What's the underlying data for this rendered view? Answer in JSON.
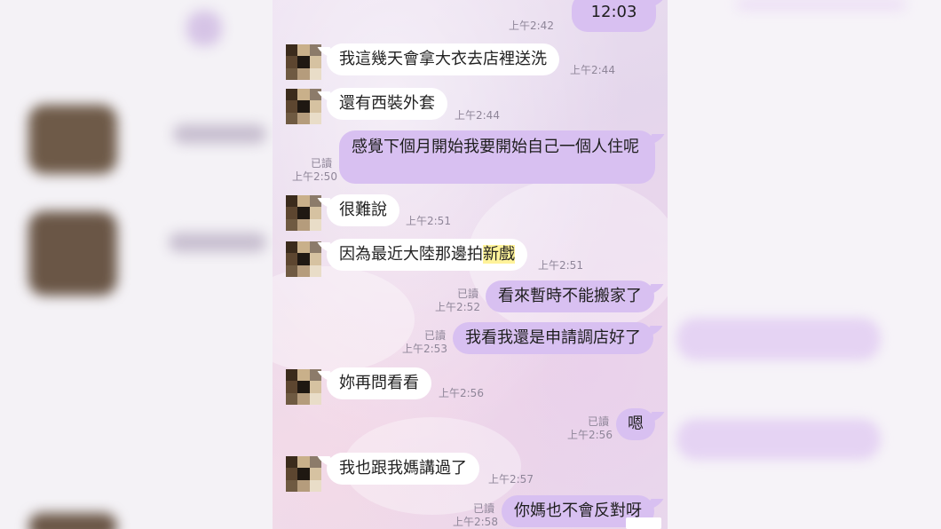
{
  "chat": {
    "messages": [
      {
        "side": "out",
        "text": "12:03",
        "time": "上午2:42",
        "read": ""
      },
      {
        "side": "in",
        "text": "我這幾天會拿大衣去店裡送洗",
        "time": "上午2:44"
      },
      {
        "side": "in",
        "text": "還有西裝外套",
        "time": "上午2:44"
      },
      {
        "side": "out",
        "text": "感覺下個月開始我要開始自己一個人住呢",
        "time": "上午2:50",
        "read": "已讀"
      },
      {
        "side": "in",
        "text": "很難說",
        "time": "上午2:51"
      },
      {
        "side": "in",
        "text_plain": "因為最近大陸那邊拍",
        "text_highlight": "新戲",
        "time": "上午2:51"
      },
      {
        "side": "out",
        "text": "看來暫時不能搬家了",
        "time": "上午2:52",
        "read": "已讀"
      },
      {
        "side": "out",
        "text": "我看我還是申請調店好了",
        "time": "上午2:53",
        "read": "已讀"
      },
      {
        "side": "in",
        "text": "妳再問看看",
        "time": "上午2:56"
      },
      {
        "side": "out",
        "text": "嗯",
        "time": "上午2:56",
        "read": "已讀"
      },
      {
        "side": "in",
        "text": "我也跟我媽講過了",
        "time": "上午2:57"
      },
      {
        "side": "out",
        "text": "你媽也不會反對呀",
        "time": "上午2:58",
        "read": "已讀"
      }
    ]
  },
  "colors": {
    "outgoing_bubble": "#d8c0f1",
    "incoming_bubble": "#ffffff",
    "highlight": "#fff39a",
    "timestamp": "#8f8699"
  }
}
